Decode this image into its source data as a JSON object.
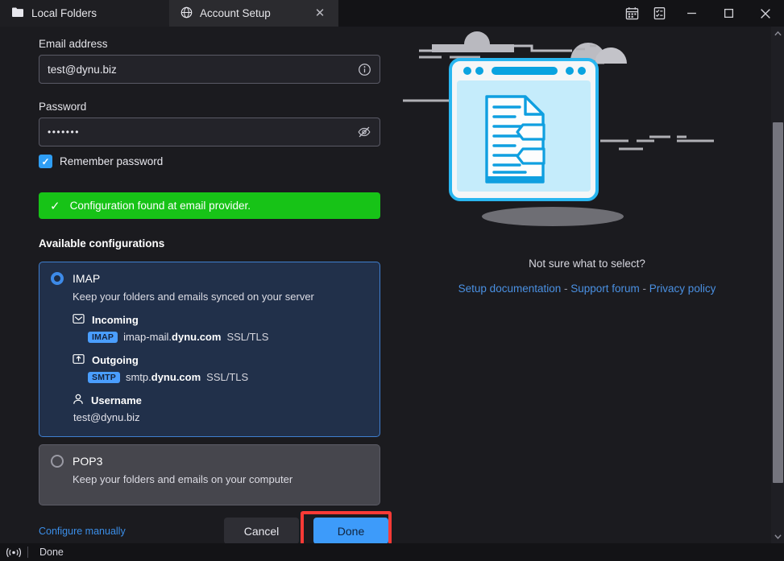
{
  "window": {
    "tabs": [
      {
        "label": "Local Folders",
        "icon": "folder-icon",
        "active": false
      },
      {
        "label": "Account Setup",
        "icon": "globe-icon",
        "active": true
      }
    ],
    "titlebar_actions": [
      {
        "name": "calendar-icon",
        "glyph": "Ὄ5"
      },
      {
        "name": "tasks-icon",
        "glyph": "☑"
      }
    ],
    "controls": {
      "minimize": "—",
      "maximize": "□",
      "close": "✕"
    },
    "close_tab": "✕"
  },
  "form": {
    "email": {
      "label": "Email address",
      "value": "test@dynu.biz",
      "placeholder": "",
      "trailing_icon": "info-icon"
    },
    "password": {
      "label": "Password",
      "value": "•••••••",
      "placeholder": "",
      "trailing_icon": "eye-off-icon"
    },
    "remember": {
      "label": "Remember password",
      "checked": true,
      "check_glyph": "✓"
    }
  },
  "banner": {
    "icon": "check-icon",
    "glyph": "✓",
    "text": "Configuration found at email provider.",
    "color": "#17c317"
  },
  "configs": {
    "heading": "Available configurations",
    "items": [
      {
        "id": "imap",
        "name": "IMAP",
        "description": "Keep your folders and emails synced on your server",
        "selected": true,
        "details": [
          {
            "icon": "inbox-icon",
            "title": "Incoming",
            "badge": "IMAP",
            "host_prefix": "imap-mail.",
            "host_domain": "dynu.com",
            "encryption": "SSL/TLS"
          },
          {
            "icon": "outbox-icon",
            "title": "Outgoing",
            "badge": "SMTP",
            "host_prefix": "smtp.",
            "host_domain": "dynu.com",
            "encryption": "SSL/TLS"
          }
        ],
        "username": {
          "icon": "person-icon",
          "title": "Username",
          "value": "test@dynu.biz"
        }
      },
      {
        "id": "pop3",
        "name": "POP3",
        "description": "Keep your folders and emails on your computer",
        "selected": false
      }
    ]
  },
  "actions": {
    "configure_manually": "Configure manually",
    "cancel": "Cancel",
    "done": "Done",
    "highlight_color": "#fb3a36",
    "done_color": "#3d9bfa"
  },
  "right_panel": {
    "question": "Not sure what to select?",
    "links": [
      {
        "label": "Setup documentation"
      },
      {
        "label": "Support forum"
      },
      {
        "label": "Privacy policy"
      }
    ],
    "separator": " - "
  },
  "scrollbar": {
    "up": "▲",
    "down": "▼"
  },
  "statusbar": {
    "icon": "broadcast-icon",
    "text": "Done"
  }
}
